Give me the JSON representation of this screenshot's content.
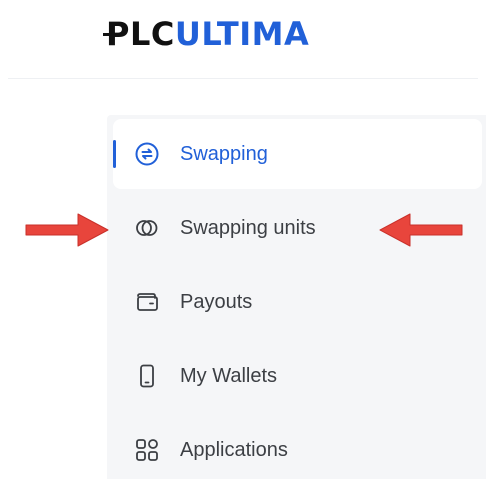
{
  "logo": {
    "part1": "PLC",
    "part2": "ULTIMA",
    "color_dark": "#111111",
    "color_accent": "#2160d8"
  },
  "sidebar": {
    "items": [
      {
        "label": "Swapping",
        "icon": "swap-arrows-icon",
        "active": true
      },
      {
        "label": "Swapping units",
        "icon": "toggle-circles-icon",
        "active": false
      },
      {
        "label": "Payouts",
        "icon": "wallet-icon",
        "active": false
      },
      {
        "label": "My Wallets",
        "icon": "phone-icon",
        "active": false
      },
      {
        "label": "Applications",
        "icon": "apps-grid-icon",
        "active": false
      }
    ]
  },
  "annotations": {
    "arrow_color": "#e8453c",
    "arrow_left_icon": "arrow-right-icon",
    "arrow_right_icon": "arrow-left-icon"
  }
}
